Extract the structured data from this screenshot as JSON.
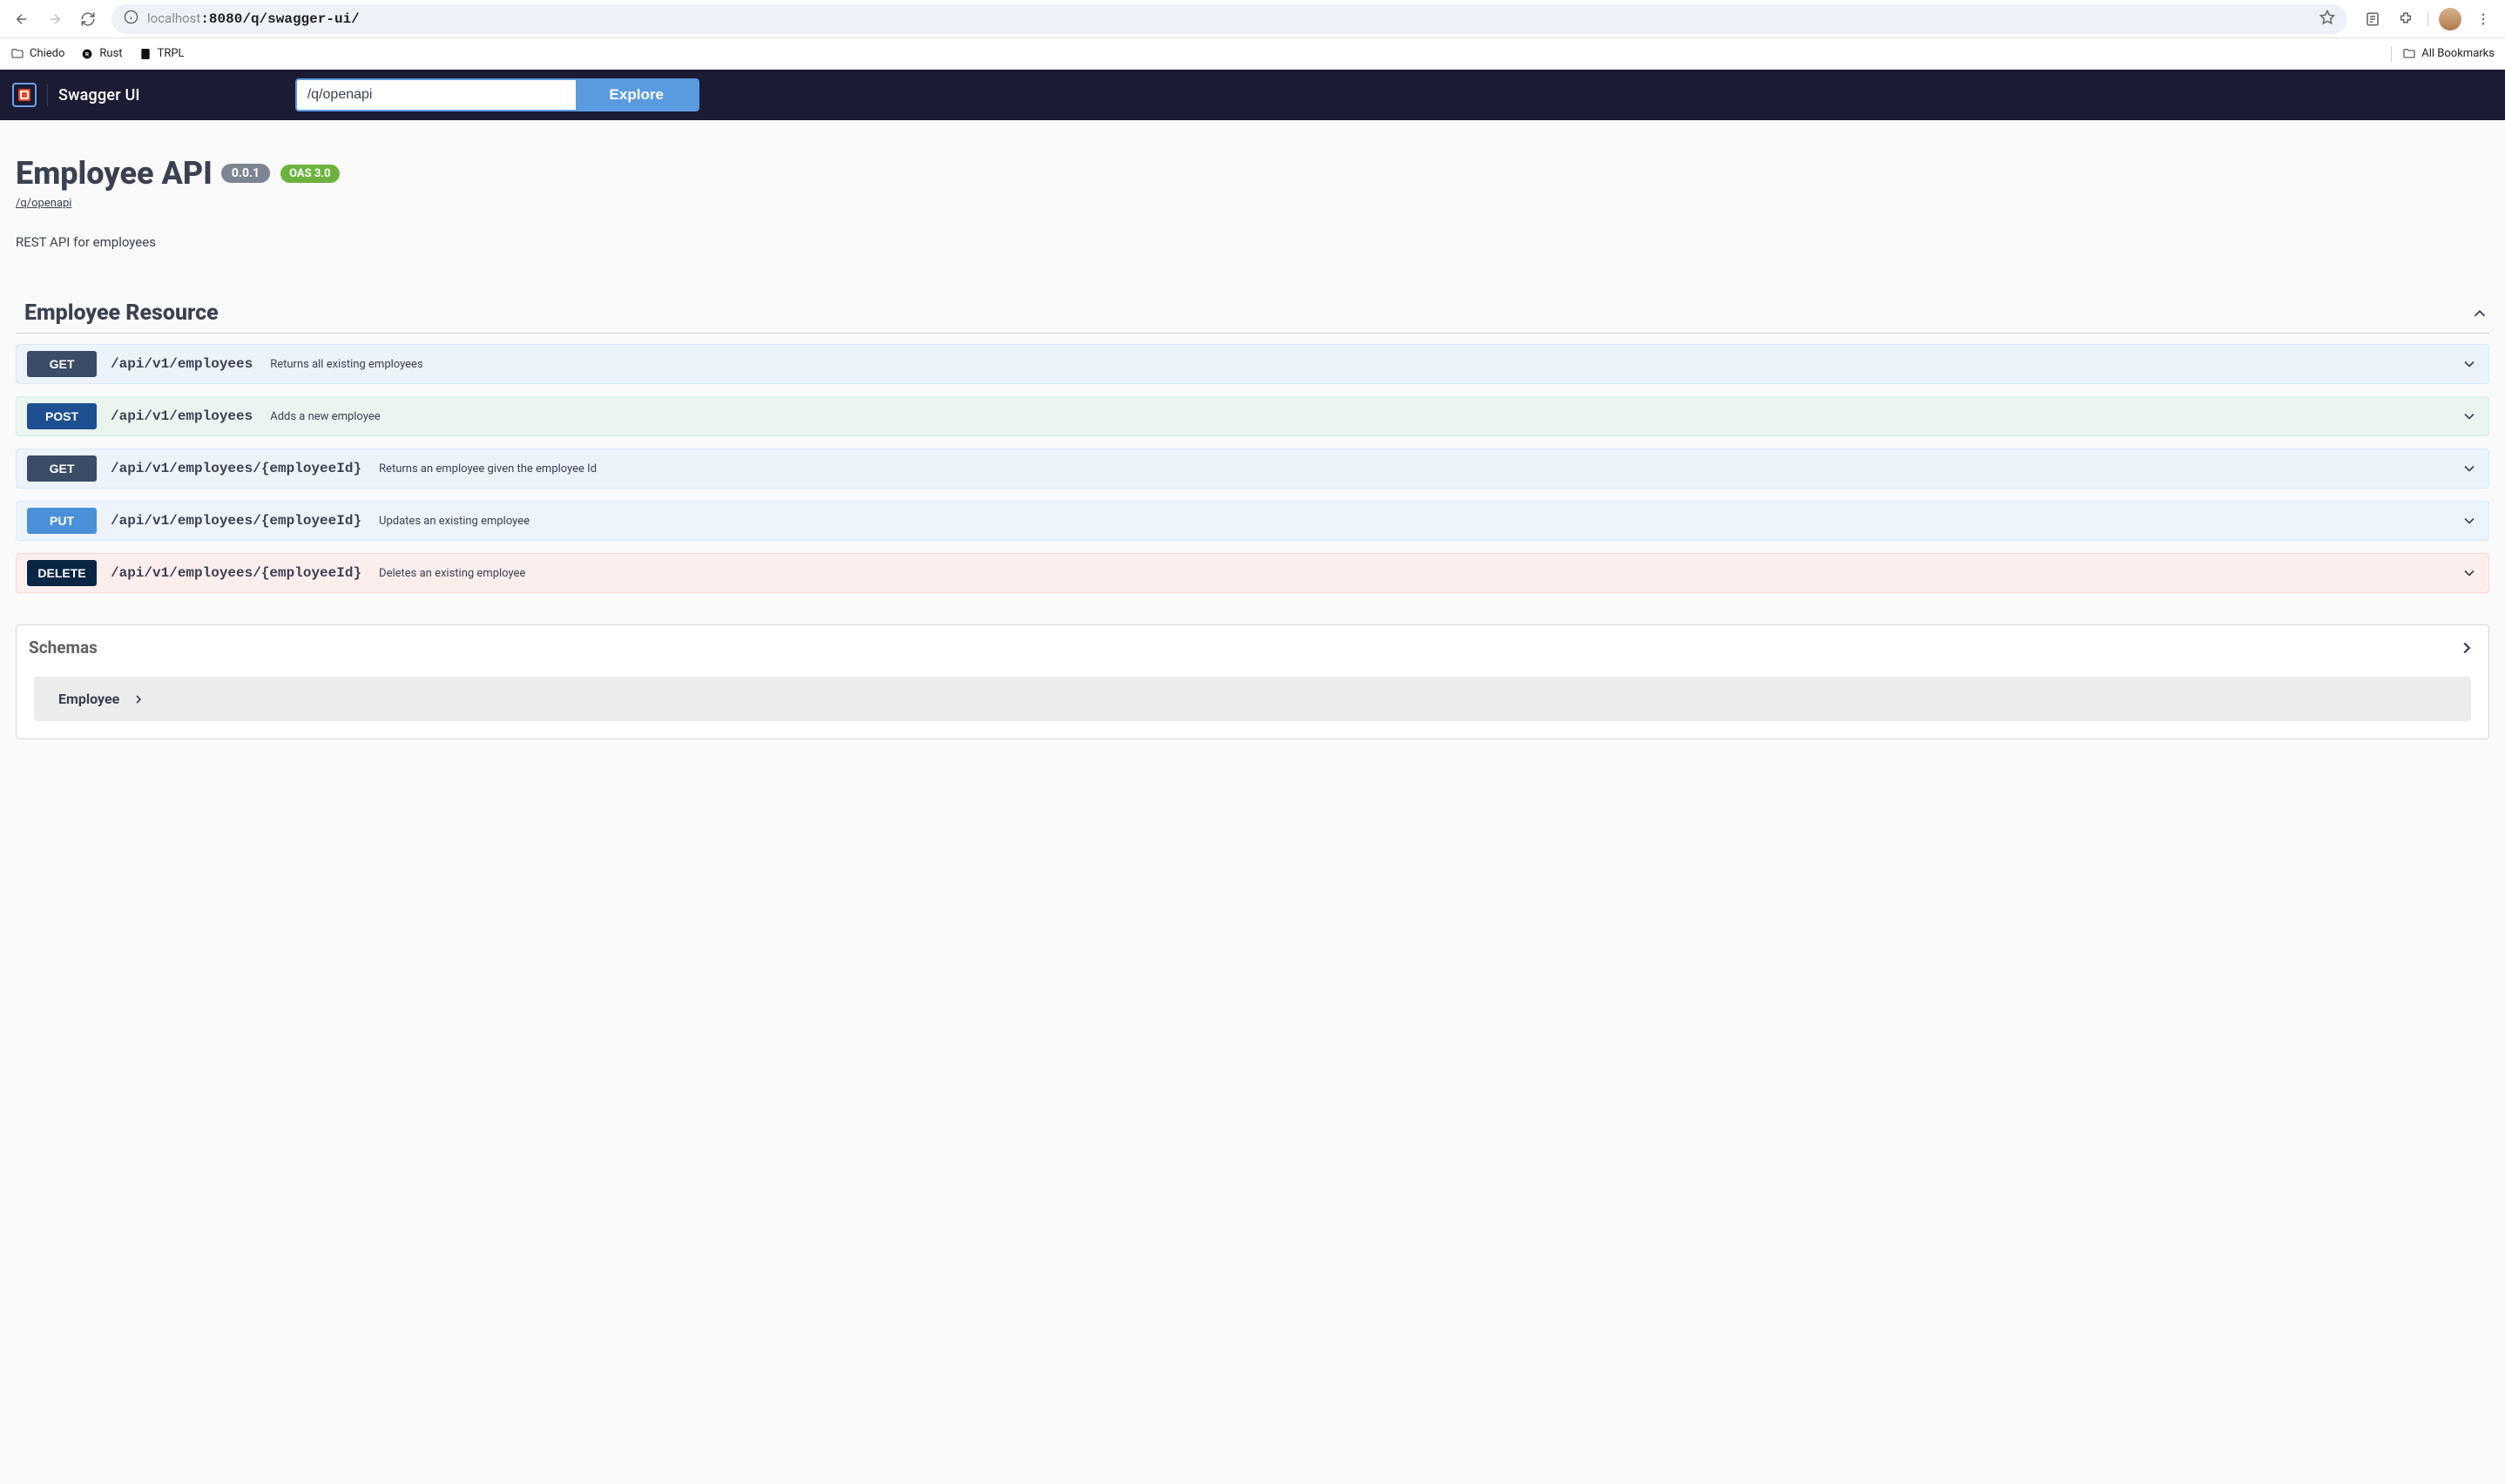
{
  "browser": {
    "url_host": "localhost",
    "url_port": ":8080",
    "url_path": "/q/swagger-ui/"
  },
  "bookmarks": {
    "items": [
      {
        "label": "Chiedo",
        "icon": "folder"
      },
      {
        "label": "Rust",
        "icon": "rust"
      },
      {
        "label": "TRPL",
        "icon": "book"
      }
    ],
    "all_label": "All Bookmarks"
  },
  "topbar": {
    "brand": "Swagger UI",
    "input_value": "/q/openapi",
    "explore_label": "Explore"
  },
  "info": {
    "title": "Employee API",
    "version": "0.0.1",
    "oas": "OAS 3.0",
    "base_url": "/q/openapi",
    "description": "REST API for employees"
  },
  "tag": {
    "name": "Employee Resource"
  },
  "operations": [
    {
      "method": "GET",
      "css": "get",
      "path": "/api/v1/employees",
      "summary": "Returns all existing employees"
    },
    {
      "method": "POST",
      "css": "post",
      "path": "/api/v1/employees",
      "summary": "Adds a new employee"
    },
    {
      "method": "GET",
      "css": "get2",
      "path": "/api/v1/employees/{employeeId}",
      "summary": "Returns an employee given the employee Id"
    },
    {
      "method": "PUT",
      "css": "put",
      "path": "/api/v1/employees/{employeeId}",
      "summary": "Updates an existing employee"
    },
    {
      "method": "DELETE",
      "css": "delete",
      "path": "/api/v1/employees/{employeeId}",
      "summary": "Deletes an existing employee"
    }
  ],
  "schemas": {
    "title": "Schemas",
    "items": [
      {
        "name": "Employee"
      }
    ]
  }
}
